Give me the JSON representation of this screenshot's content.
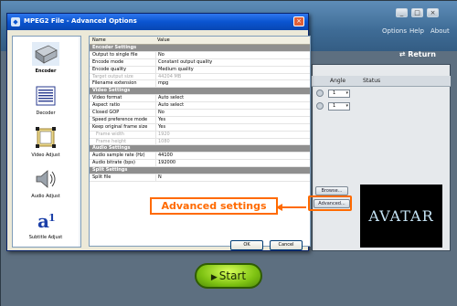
{
  "app": {
    "title": "",
    "window_controls": [
      "_",
      "□",
      "×"
    ],
    "menu": [
      "Options",
      "Help",
      "About"
    ],
    "return_label": "Return",
    "table_headers": {
      "angle": "Angle",
      "status": "Status"
    },
    "rows": [
      {
        "angle": "1"
      },
      {
        "angle": "1"
      }
    ],
    "browse_label": "Browse...",
    "advanced_label": "Advanced...",
    "preview_text": "AVATAR",
    "start_label": "Start"
  },
  "dialog": {
    "title": "MPEG2 File - Advanced Options",
    "close_glyph": "×",
    "sidebar": [
      {
        "label": "Encoder",
        "icon": "encoder-icon",
        "active": true
      },
      {
        "label": "Decoder",
        "icon": "decoder-icon",
        "active": false
      },
      {
        "label": "Video Adjust",
        "icon": "video-adjust-icon",
        "active": false
      },
      {
        "label": "Audio Adjust",
        "icon": "audio-adjust-icon",
        "active": false
      },
      {
        "label": "Subtitle Adjust",
        "icon": "subtitle-adjust-icon",
        "active": false
      }
    ],
    "grid": {
      "headers": {
        "name": "Name",
        "value": "Value"
      },
      "rows": [
        {
          "name": "Encoder Settings",
          "value": "",
          "type": "section"
        },
        {
          "name": "Output to single file",
          "value": "No",
          "type": "row"
        },
        {
          "name": "Encode mode",
          "value": "Constant output quality",
          "type": "row"
        },
        {
          "name": "Encode quality",
          "value": "Medium quality",
          "type": "row"
        },
        {
          "name": "Target output size",
          "value": "44204 MB",
          "type": "disabled"
        },
        {
          "name": "Filename extension",
          "value": "mpg",
          "type": "row"
        },
        {
          "name": "Video Settings",
          "value": "",
          "type": "section"
        },
        {
          "name": "Video format",
          "value": "Auto select",
          "type": "row"
        },
        {
          "name": "Aspect ratio",
          "value": "Auto select",
          "type": "row"
        },
        {
          "name": "Closed GOP",
          "value": "No",
          "type": "row"
        },
        {
          "name": "Speed preference mode",
          "value": "Yes",
          "type": "row"
        },
        {
          "name": "Keep original frame size",
          "value": "Yes",
          "type": "row"
        },
        {
          "name": "Frame width",
          "value": "1920",
          "type": "disabled-sub"
        },
        {
          "name": "Frame height",
          "value": "1080",
          "type": "disabled-sub"
        },
        {
          "name": "Audio Settings",
          "value": "",
          "type": "section"
        },
        {
          "name": "Audio sample rate (Hz)",
          "value": "44100",
          "type": "row"
        },
        {
          "name": "Audio bitrate (bps)",
          "value": "192000",
          "type": "row"
        },
        {
          "name": "Split Settings",
          "value": "",
          "type": "section"
        },
        {
          "name": "Split file",
          "value": "N",
          "type": "row"
        }
      ]
    },
    "ok_label": "OK",
    "cancel_label": "Cancel"
  },
  "annotation": {
    "text": "Advanced settings",
    "color": "#ff6a00"
  }
}
